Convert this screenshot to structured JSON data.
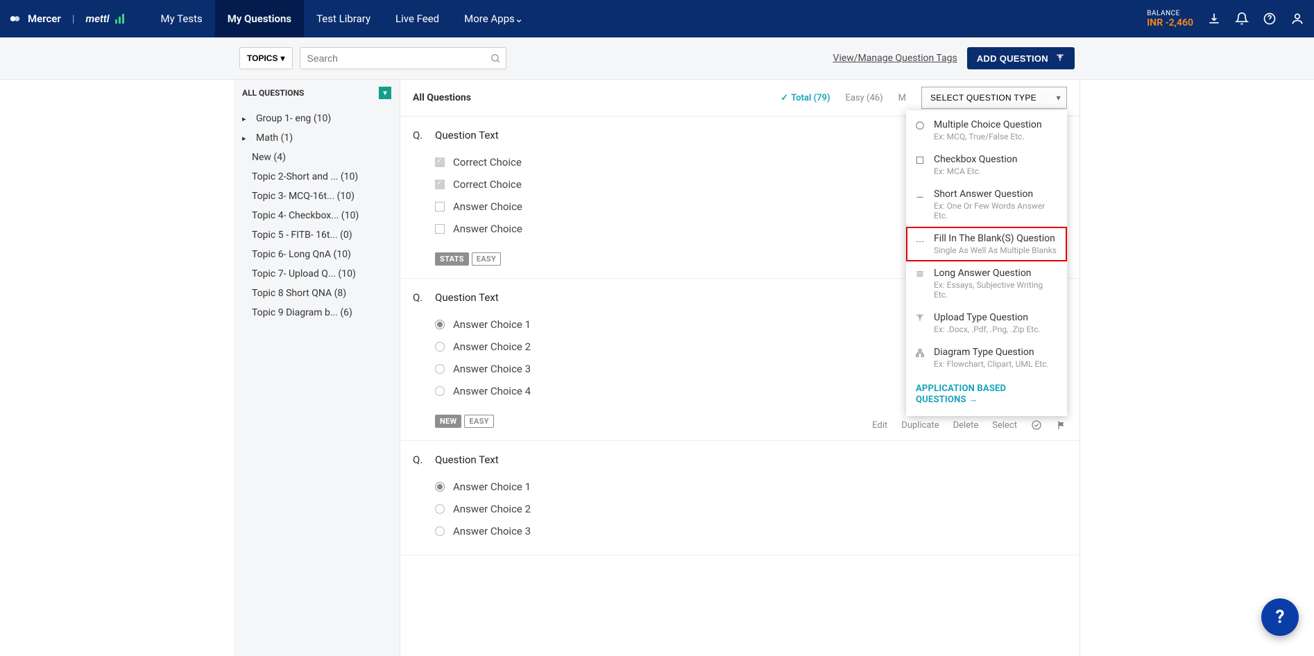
{
  "header": {
    "brand1": "Mercer",
    "brand2": "mettl",
    "nav": [
      "My Tests",
      "My Questions",
      "Test Library",
      "Live Feed",
      "More Apps"
    ],
    "nav_active_index": 1,
    "balance_label": "BALANCE",
    "balance_amount": "INR -2,460"
  },
  "toolbar": {
    "topics_btn": "TOPICS",
    "search_placeholder": "Search",
    "manage_tags": "View/Manage Question Tags",
    "add_question": "ADD QUESTION"
  },
  "sidebar": {
    "all_label": "ALL QUESTIONS",
    "topics": [
      {
        "label": "Group 1- eng (10)",
        "has_children": true
      },
      {
        "label": "Math (1)",
        "has_children": true
      },
      {
        "label": "New (4)",
        "has_children": false
      },
      {
        "label": "Topic 2-Short and ... (10)",
        "has_children": false
      },
      {
        "label": "Topic 3- MCQ-16t... (10)",
        "has_children": false
      },
      {
        "label": "Topic 4- Checkbox... (10)",
        "has_children": false
      },
      {
        "label": "Topic 5 - FITB- 16t... (0)",
        "has_children": false
      },
      {
        "label": "Topic 6- Long QnA (10)",
        "has_children": false
      },
      {
        "label": "Topic 7- Upload Q... (10)",
        "has_children": false
      },
      {
        "label": "Topic 8 Short QNA (8)",
        "has_children": false
      },
      {
        "label": "Topic 9 Diagram b... (6)",
        "has_children": false
      }
    ]
  },
  "content": {
    "title": "All Questions",
    "filters": {
      "total": "Total (79)",
      "easy": "Easy (46)",
      "more_initial": "M"
    },
    "select_type_label": "SELECT QUESTION TYPE",
    "question_types": [
      {
        "title": "Multiple Choice Question",
        "sub": "Ex: MCQ, True/False Etc.",
        "icon": "radio"
      },
      {
        "title": "Checkbox Question",
        "sub": "Ex: MCA Etc.",
        "icon": "checkbox"
      },
      {
        "title": "Short Answer Question",
        "sub": "Ex: One Or Few Words Answer Etc.",
        "icon": "line"
      },
      {
        "title": "Fill In The Blank(S) Question",
        "sub": "Single As Well As Multiple Blanks",
        "icon": "dashes",
        "highlighted": true
      },
      {
        "title": "Long Answer Question",
        "sub": "Ex: Essays, Subjective Writing Etc.",
        "icon": "para"
      },
      {
        "title": "Upload Type Question",
        "sub": "Ex: .Docx, .Pdf, .Png, .Zip Etc.",
        "icon": "upload"
      },
      {
        "title": "Diagram Type Question",
        "sub": "Ex: Flowchart, Clipart, UML Etc.",
        "icon": "diagram"
      }
    ],
    "app_based_link": "APPLICATION BASED QUESTIONS →",
    "questions": [
      {
        "text": "Question Text",
        "ctrl": "checkbox",
        "choices": [
          {
            "label": "Correct Choice",
            "checked": true
          },
          {
            "label": "Correct Choice",
            "checked": true
          },
          {
            "label": "Answer Choice",
            "checked": false
          },
          {
            "label": "Answer Choice",
            "checked": false
          }
        ],
        "badges": [
          {
            "text": "STATS",
            "style": "solid"
          },
          {
            "text": "EASY",
            "style": "outline"
          }
        ],
        "show_actions": false
      },
      {
        "text": "Question Text",
        "ctrl": "radio",
        "choices": [
          {
            "label": "Answer Choice 1",
            "checked": true
          },
          {
            "label": "Answer Choice 2",
            "checked": false
          },
          {
            "label": "Answer Choice 3",
            "checked": false
          },
          {
            "label": "Answer Choice 4",
            "checked": false
          }
        ],
        "badges": [
          {
            "text": "NEW",
            "style": "solid"
          },
          {
            "text": "EASY",
            "style": "outline"
          }
        ],
        "show_actions": true
      },
      {
        "text": "Question Text",
        "ctrl": "radio",
        "choices": [
          {
            "label": "Answer Choice 1",
            "checked": true
          },
          {
            "label": "Answer Choice 2",
            "checked": false
          },
          {
            "label": "Answer Choice 3",
            "checked": false
          }
        ],
        "badges": [],
        "show_actions": false
      }
    ],
    "actions": [
      "Edit",
      "Duplicate",
      "Delete",
      "Select"
    ],
    "q_marker": "Q."
  },
  "help_glyph": "?"
}
